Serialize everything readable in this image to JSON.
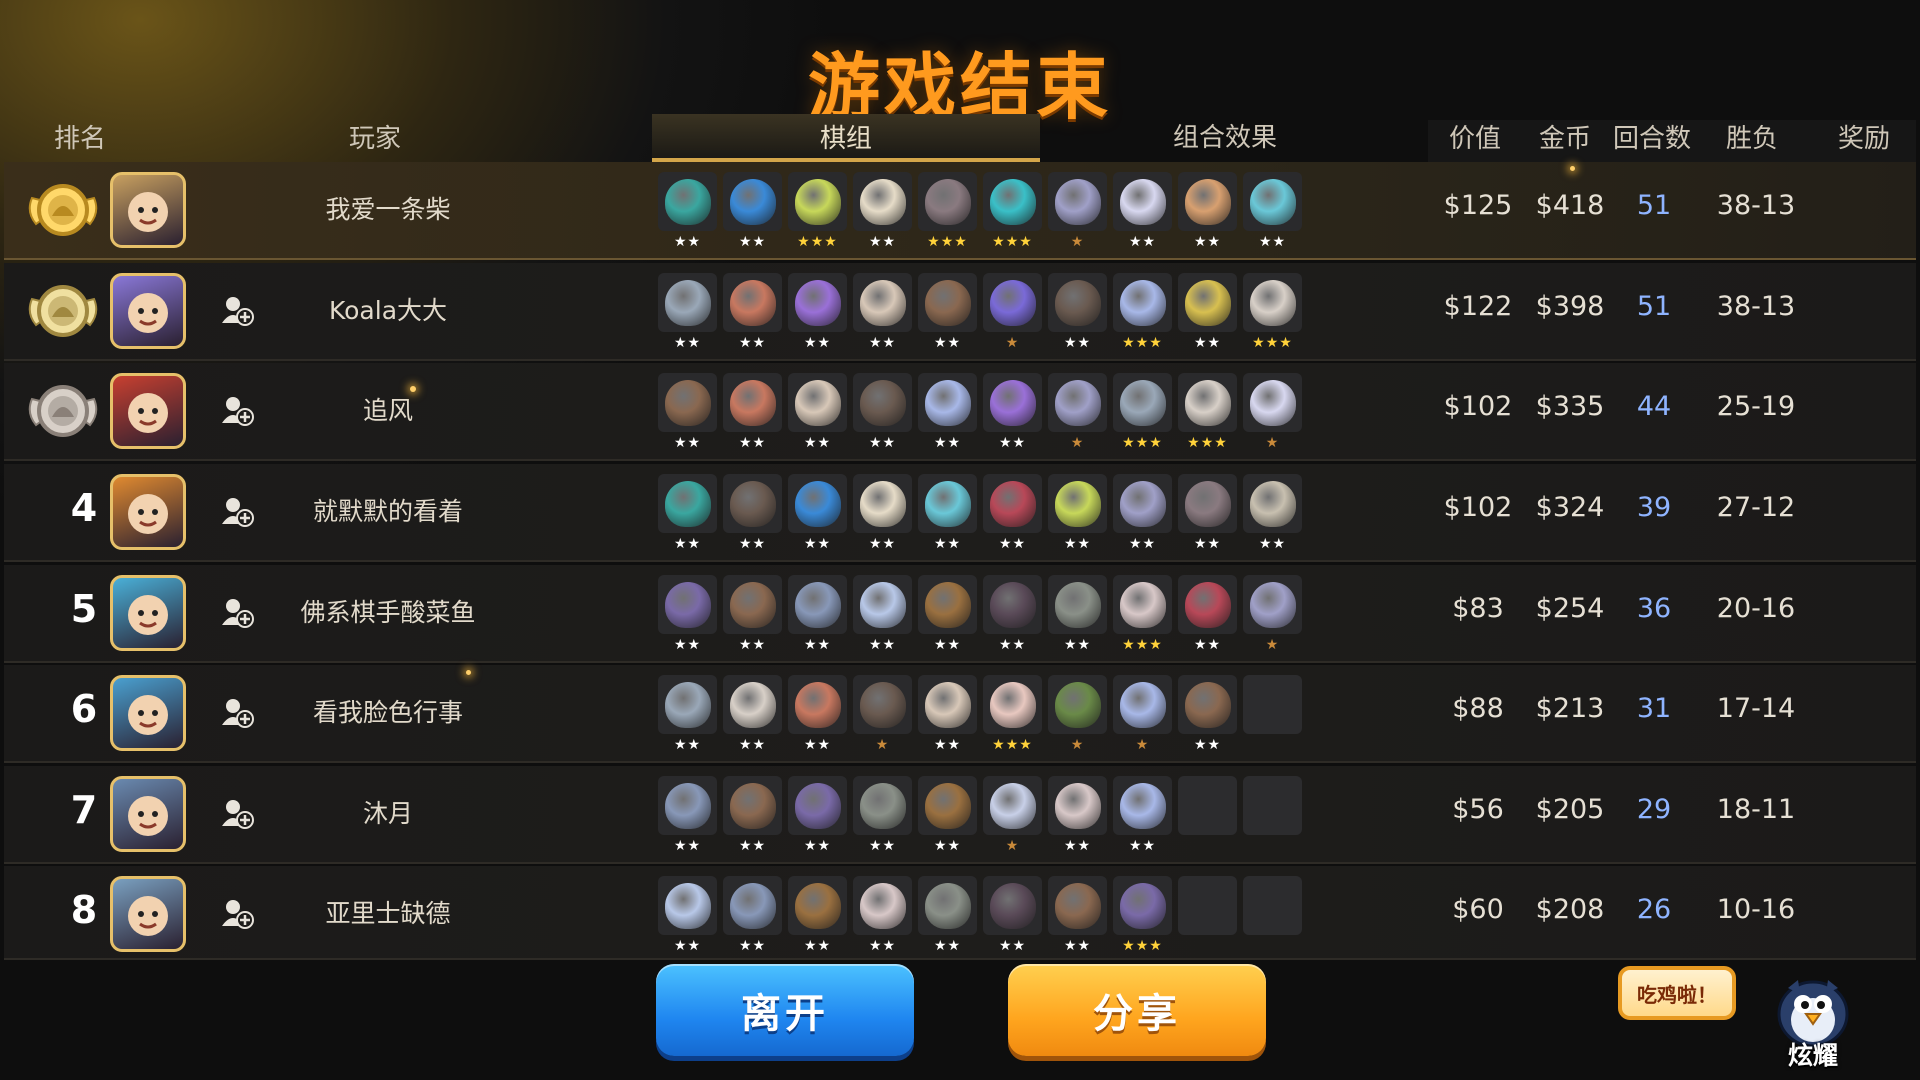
{
  "title": "游戏结束",
  "headers": {
    "rank": "排名",
    "player": "玩家",
    "tab_pieces": "棋组",
    "tab_synergy": "组合效果",
    "value": "价值",
    "gold": "金币",
    "rounds": "回合数",
    "winloss": "胜负",
    "reward": "奖励"
  },
  "colors": {
    "title": "#ff9a1e",
    "accent_gold": "#e6c06a",
    "rounds_blue": "#8fb4ff",
    "star_gold": "#ffd23a",
    "star_bronze": "#c98a3a",
    "star_white": "#ffffff"
  },
  "rows": [
    {
      "rank_label": "",
      "medal": "gold-medal-icon",
      "avatar_icon": "avatar-hero-1",
      "name": "我爱一条柴",
      "show_add": false,
      "value": "$125",
      "gold": "$418",
      "rounds": "51",
      "winloss": "38-13",
      "pieces": [
        {
          "color": "#3aa7a0",
          "stars": "★★",
          "star_color": "white"
        },
        {
          "color": "#3a8ad8",
          "stars": "★★",
          "star_color": "white"
        },
        {
          "color": "#c7d85a",
          "stars": "★★★",
          "star_color": "gold"
        },
        {
          "color": "#e6dcc8",
          "stars": "★★",
          "star_color": "white"
        },
        {
          "color": "#8a7a80",
          "stars": "★★★",
          "star_color": "gold"
        },
        {
          "color": "#3ac0c8",
          "stars": "★★★",
          "star_color": "gold"
        },
        {
          "color": "#a0a0c8",
          "stars": "★",
          "star_color": "bronze"
        },
        {
          "color": "#d8d8f0",
          "stars": "★★",
          "star_color": "white"
        },
        {
          "color": "#d8a070",
          "stars": "★★",
          "star_color": "white"
        },
        {
          "color": "#6ac8d8",
          "stars": "★★",
          "star_color": "white"
        }
      ]
    },
    {
      "rank_label": "",
      "medal": "silver-medal-icon",
      "avatar_icon": "avatar-hero-2",
      "name": "Koala大大",
      "show_add": true,
      "value": "$122",
      "gold": "$398",
      "rounds": "51",
      "winloss": "38-13",
      "pieces": [
        {
          "color": "#9aa8b8",
          "stars": "★★",
          "star_color": "white"
        },
        {
          "color": "#c87860",
          "stars": "★★",
          "star_color": "white"
        },
        {
          "color": "#9a70d8",
          "stars": "★★",
          "star_color": "white"
        },
        {
          "color": "#d8c8b8",
          "stars": "★★",
          "star_color": "white"
        },
        {
          "color": "#8a6850",
          "stars": "★★",
          "star_color": "white"
        },
        {
          "color": "#7a6ad8",
          "stars": "★",
          "star_color": "bronze"
        },
        {
          "color": "#6a5a50",
          "stars": "★★",
          "star_color": "white"
        },
        {
          "color": "#a8b8e8",
          "stars": "★★★",
          "star_color": "gold"
        },
        {
          "color": "#d8c050",
          "stars": "★★",
          "star_color": "white"
        },
        {
          "color": "#d8d0c8",
          "stars": "★★★",
          "star_color": "gold"
        }
      ]
    },
    {
      "rank_label": "",
      "medal": "bronze-medal-icon",
      "avatar_icon": "avatar-hero-3",
      "name": "追风",
      "show_add": true,
      "value": "$102",
      "gold": "$335",
      "rounds": "44",
      "winloss": "25-19",
      "pieces": [
        {
          "color": "#8a6850",
          "stars": "★★",
          "star_color": "white"
        },
        {
          "color": "#c87860",
          "stars": "★★",
          "star_color": "white"
        },
        {
          "color": "#d8c8b8",
          "stars": "★★",
          "star_color": "white"
        },
        {
          "color": "#6a5a50",
          "stars": "★★",
          "star_color": "white"
        },
        {
          "color": "#a8b8e8",
          "stars": "★★",
          "star_color": "white"
        },
        {
          "color": "#9a70d8",
          "stars": "★★",
          "star_color": "white"
        },
        {
          "color": "#a0a0c8",
          "stars": "★",
          "star_color": "bronze"
        },
        {
          "color": "#9aa8b8",
          "stars": "★★★",
          "star_color": "gold"
        },
        {
          "color": "#d8d0c8",
          "stars": "★★★",
          "star_color": "gold"
        },
        {
          "color": "#d8d8f0",
          "stars": "★",
          "star_color": "bronze"
        }
      ]
    },
    {
      "rank_label": "4",
      "medal": "",
      "avatar_icon": "avatar-hero-4",
      "name": "就默默的看着",
      "show_add": true,
      "value": "$102",
      "gold": "$324",
      "rounds": "39",
      "winloss": "27-12",
      "pieces": [
        {
          "color": "#3aa7a0",
          "stars": "★★",
          "star_color": "white"
        },
        {
          "color": "#6a5a50",
          "stars": "★★",
          "star_color": "white"
        },
        {
          "color": "#3a8ad8",
          "stars": "★★",
          "star_color": "white"
        },
        {
          "color": "#e6dcc8",
          "stars": "★★",
          "star_color": "white"
        },
        {
          "color": "#6ac8d8",
          "stars": "★★",
          "star_color": "white"
        },
        {
          "color": "#b84858",
          "stars": "★★",
          "star_color": "white"
        },
        {
          "color": "#c7d85a",
          "stars": "★★",
          "star_color": "white"
        },
        {
          "color": "#a0a0c8",
          "stars": "★★",
          "star_color": "white"
        },
        {
          "color": "#8a7a80",
          "stars": "★★",
          "star_color": "white"
        },
        {
          "color": "#c8c0b0",
          "stars": "★★",
          "star_color": "white"
        }
      ]
    },
    {
      "rank_label": "5",
      "medal": "",
      "avatar_icon": "avatar-hero-5",
      "name": "佛系棋手酸菜鱼",
      "show_add": true,
      "value": "$83",
      "gold": "$254",
      "rounds": "36",
      "winloss": "20-16",
      "pieces": [
        {
          "color": "#7a6aa8",
          "stars": "★★",
          "star_color": "white"
        },
        {
          "color": "#8a6850",
          "stars": "★★",
          "star_color": "white"
        },
        {
          "color": "#8898b8",
          "stars": "★★",
          "star_color": "white"
        },
        {
          "color": "#b8c8e8",
          "stars": "★★",
          "star_color": "white"
        },
        {
          "color": "#9a7040",
          "stars": "★★",
          "star_color": "white"
        },
        {
          "color": "#5a4a58",
          "stars": "★★",
          "star_color": "white"
        },
        {
          "color": "#8a9088",
          "stars": "★★",
          "star_color": "white"
        },
        {
          "color": "#d8c8c8",
          "stars": "★★★",
          "star_color": "gold"
        },
        {
          "color": "#b84858",
          "stars": "★★",
          "star_color": "white"
        },
        {
          "color": "#a0a0c8",
          "stars": "★",
          "star_color": "bronze"
        }
      ]
    },
    {
      "rank_label": "6",
      "medal": "",
      "avatar_icon": "avatar-hero-6",
      "name": "看我脸色行事",
      "show_add": true,
      "value": "$88",
      "gold": "$213",
      "rounds": "31",
      "winloss": "17-14",
      "pieces": [
        {
          "color": "#9aa8b8",
          "stars": "★★",
          "star_color": "white"
        },
        {
          "color": "#d8d0c8",
          "stars": "★★",
          "star_color": "white"
        },
        {
          "color": "#c87860",
          "stars": "★★",
          "star_color": "white"
        },
        {
          "color": "#6a5a50",
          "stars": "★",
          "star_color": "bronze"
        },
        {
          "color": "#d8c8b8",
          "stars": "★★",
          "star_color": "white"
        },
        {
          "color": "#e8c8c0",
          "stars": "★★★",
          "star_color": "gold"
        },
        {
          "color": "#6a8a48",
          "stars": "★",
          "star_color": "bronze"
        },
        {
          "color": "#a8b8e8",
          "stars": "★",
          "star_color": "bronze"
        },
        {
          "color": "#8a6850",
          "stars": "★★",
          "star_color": "white"
        },
        {
          "color": "",
          "stars": "",
          "star_color": "white"
        }
      ]
    },
    {
      "rank_label": "7",
      "medal": "",
      "avatar_icon": "avatar-hero-7",
      "name": "沐月",
      "show_add": true,
      "value": "$56",
      "gold": "$205",
      "rounds": "29",
      "winloss": "18-11",
      "pieces": [
        {
          "color": "#8898b8",
          "stars": "★★",
          "star_color": "white"
        },
        {
          "color": "#8a6850",
          "stars": "★★",
          "star_color": "white"
        },
        {
          "color": "#7a6aa8",
          "stars": "★★",
          "star_color": "white"
        },
        {
          "color": "#8a9088",
          "stars": "★★",
          "star_color": "white"
        },
        {
          "color": "#9a7040",
          "stars": "★★",
          "star_color": "white"
        },
        {
          "color": "#c8d0e8",
          "stars": "★",
          "star_color": "bronze"
        },
        {
          "color": "#d8c8c8",
          "stars": "★★",
          "star_color": "white"
        },
        {
          "color": "#a8b8e8",
          "stars": "★★",
          "star_color": "white"
        },
        {
          "color": "",
          "stars": "",
          "star_color": "white"
        },
        {
          "color": "",
          "stars": "",
          "star_color": "white"
        }
      ]
    },
    {
      "rank_label": "8",
      "medal": "",
      "avatar_icon": "avatar-hero-8",
      "name": "亚里士缺德",
      "show_add": true,
      "value": "$60",
      "gold": "$208",
      "rounds": "26",
      "winloss": "10-16",
      "pieces": [
        {
          "color": "#b8c8e8",
          "stars": "★★",
          "star_color": "white"
        },
        {
          "color": "#8898b8",
          "stars": "★★",
          "star_color": "white"
        },
        {
          "color": "#9a7040",
          "stars": "★★",
          "star_color": "white"
        },
        {
          "color": "#d8c8c8",
          "stars": "★★",
          "star_color": "white"
        },
        {
          "color": "#8a9088",
          "stars": "★★",
          "star_color": "white"
        },
        {
          "color": "#5a4a58",
          "stars": "★★",
          "star_color": "white"
        },
        {
          "color": "#8a6850",
          "stars": "★★",
          "star_color": "white"
        },
        {
          "color": "#7a6aa8",
          "stars": "★★★",
          "star_color": "gold"
        },
        {
          "color": "",
          "stars": "",
          "star_color": "white"
        },
        {
          "color": "",
          "stars": "",
          "star_color": "white"
        }
      ]
    }
  ],
  "buttons": {
    "leave": "离开",
    "share": "分享"
  },
  "bubble_text": "吃鸡啦！",
  "mascot_label": "炫耀"
}
